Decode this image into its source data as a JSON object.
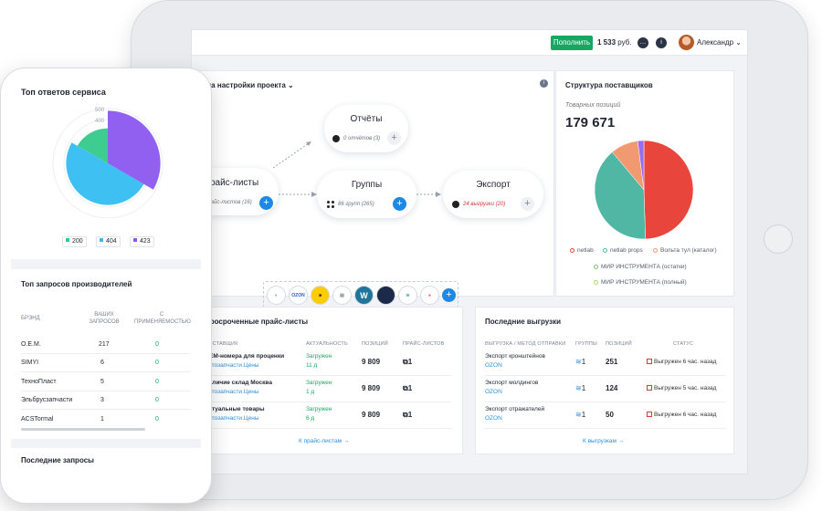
{
  "topbar": {
    "topup_label": "Пополнить",
    "balance_value": "1 533",
    "balance_currency": "руб.",
    "chat_icon": "chat-icon",
    "info_icon": "info-icon",
    "username": "Александр"
  },
  "setup": {
    "title": "Схема настройки проекта",
    "nodes": {
      "reports": {
        "title": "Отчёты",
        "sub": "0 отчётов (3)"
      },
      "pricelists": {
        "title": "Прайс-листы",
        "sub": "8 прайс-листов (16)"
      },
      "groups": {
        "title": "Группы",
        "sub": "86 групп (265)"
      },
      "export": {
        "title": "Экспорт",
        "sub": "24 выгрузки (20)"
      }
    },
    "supplier_logos": [
      "ozon-circle",
      "OZON",
      "yandex",
      "sber",
      "wordpress",
      "yandex-market",
      "aliexpress",
      "avito"
    ],
    "ozon_text": "OZON"
  },
  "structure": {
    "title": "Структура поставщиков",
    "subtitle": "Товарных позиций",
    "total": "179 671",
    "legend": [
      {
        "label": "netlab",
        "color": "#e8453c"
      },
      {
        "label": "netlab props",
        "color": "#4fb7a4"
      },
      {
        "label": "Вольта тул (каталог)",
        "color": "#f19a72"
      },
      {
        "label": "МИР ИНСТРУМЕНТА (остатки)",
        "color": "#7cc36a"
      },
      {
        "label": "МИР ИНСТРУМЕНТА (полный)",
        "color": "#a8d86e"
      }
    ]
  },
  "chart_data": [
    {
      "type": "pie",
      "title": "Структура поставщиков",
      "categories": [
        "netlab",
        "netlab props",
        "Вольта тул (каталог)",
        "МИР ИНСТРУМЕНТА (остатки)",
        "МИР ИНСТРУМЕНТА (полный)"
      ],
      "values": [
        49,
        39,
        9,
        0,
        2
      ],
      "colors": [
        "#e8453c",
        "#4fb7a4",
        "#f19a72",
        "#8bc34a",
        "#9b6cf0"
      ]
    },
    {
      "type": "polar_area",
      "title": "Топ ответов сервиса",
      "categories": [
        "200",
        "404",
        "423"
      ],
      "values": [
        320,
        380,
        480
      ],
      "ylim": [
        0,
        500
      ],
      "ticks": [
        "500",
        "400"
      ],
      "colors": [
        "#34c98a",
        "#35bdf2",
        "#8b57f0"
      ]
    }
  ],
  "expired": {
    "title": "Просроченные прайс-листы",
    "headers": [
      "Поставщик",
      "Актуальность",
      "Позиций",
      "Прайс-листов"
    ],
    "rows": [
      {
        "name": "OEM-номера для проценки",
        "source": "Автозапчасти.Цены",
        "status": "Загружен",
        "age": "11 д",
        "positions": "9 809",
        "lists": "1"
      },
      {
        "name": "Наличие склад Москва",
        "source": "Автозапчасти.Цены",
        "status": "Загружен",
        "age": "1 д",
        "positions": "9 809",
        "lists": "1"
      },
      {
        "name": "Актуальные товары",
        "source": "Автозапчасти.Цены",
        "status": "Загружен",
        "age": "6 д",
        "positions": "9 809",
        "lists": "1"
      }
    ],
    "footer": "К прайс-листам →"
  },
  "exports": {
    "title": "Последние выгрузки",
    "headers": [
      "Выгрузка / Метод отправки",
      "Группы",
      "Позиций",
      "Статус"
    ],
    "rows": [
      {
        "name": "Экспорт кронштейнов",
        "method": "OZON",
        "groups": "1",
        "positions": "251",
        "status": "Выгружен 6 час. назад"
      },
      {
        "name": "Экспорт молдингов",
        "method": "OZON",
        "groups": "1",
        "positions": "124",
        "status": "Выгружен 5 час. назад"
      },
      {
        "name": "Экспорт отражателей",
        "method": "OZON",
        "groups": "1",
        "positions": "50",
        "status": "Выгружен 6 час. назад"
      }
    ],
    "footer": "К выгрузкам →"
  },
  "phone": {
    "responses_title": "Топ ответов сервиса",
    "badges": [
      {
        "label": "200",
        "color": "#34c98a"
      },
      {
        "label": "404",
        "color": "#35bdf2"
      },
      {
        "label": "423",
        "color": "#8b57f0"
      }
    ],
    "manufacturers_title": "Топ запросов производителей",
    "headers": [
      "Брэнд",
      "Ваших запросов",
      "С применяемостью"
    ],
    "rows": [
      {
        "brand": "O.E.M.",
        "requests": "217",
        "applicability": "0"
      },
      {
        "brand": "SIMYI",
        "requests": "6",
        "applicability": "0"
      },
      {
        "brand": "ТехноПласт",
        "requests": "5",
        "applicability": "0"
      },
      {
        "brand": "Эльбрусзапчасти",
        "requests": "3",
        "applicability": "0"
      },
      {
        "brand": "ACSTormal",
        "requests": "1",
        "applicability": "0"
      }
    ],
    "recent_title": "Последние запросы"
  }
}
